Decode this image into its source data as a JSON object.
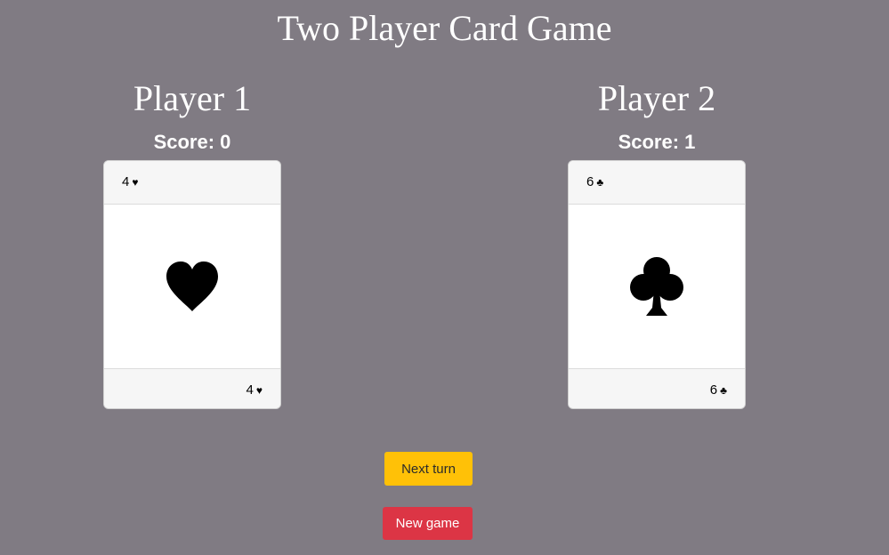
{
  "header": {
    "title": "Two Player Card Game"
  },
  "players": [
    {
      "name": "Player 1",
      "score_label": "Score:",
      "score": "0",
      "card": {
        "rank": "4",
        "suit": "♥",
        "suit_name": "heart-icon"
      }
    },
    {
      "name": "Player 2",
      "score_label": "Score:",
      "score": "1",
      "card": {
        "rank": "6",
        "suit": "♣",
        "suit_name": "club-icon"
      }
    }
  ],
  "controls": {
    "next_turn_label": "Next turn",
    "new_game_label": "New game"
  },
  "colors": {
    "background": "#807b83",
    "next_turn": "#ffc107",
    "new_game": "#dc3545"
  }
}
